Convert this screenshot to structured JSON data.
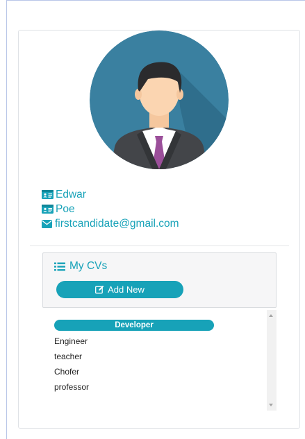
{
  "profile": {
    "first_name": "Edwar",
    "last_name": "Poe",
    "email": "firstcandidate@gmail.com",
    "avatar_icon": "user-avatar"
  },
  "cvs": {
    "title": "My CVs",
    "add_label": "Add New",
    "items": [
      {
        "label": "Developer",
        "active": true
      },
      {
        "label": "Engineer",
        "active": false
      },
      {
        "label": "teacher",
        "active": false
      },
      {
        "label": "Chofer",
        "active": false
      },
      {
        "label": "professor",
        "active": false
      }
    ]
  },
  "colors": {
    "accent": "#17a2b8",
    "avatar_bg": "#3a80a0",
    "tie": "#9b4f9a"
  }
}
